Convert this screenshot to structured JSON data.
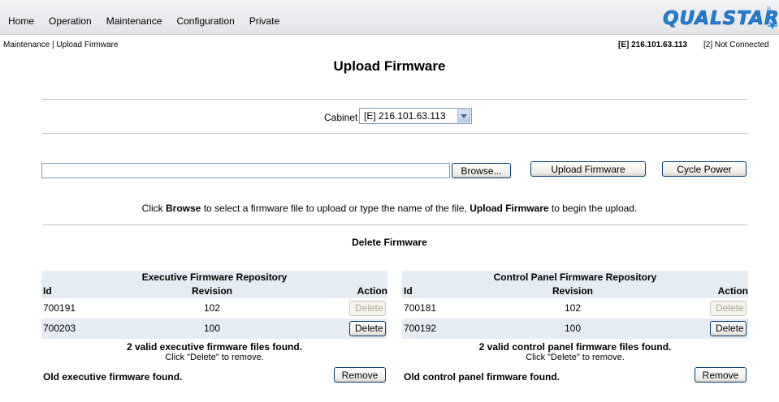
{
  "nav": [
    "Home",
    "Operation",
    "Maintenance",
    "Configuration",
    "Private"
  ],
  "logo": "QUALSTAR",
  "breadcrumb": "Maintenance | Upload Firmware",
  "connection": {
    "primary": "[E] 216.101.63.113",
    "secondary": "[2] Not Connected"
  },
  "page_title": "Upload Firmware",
  "cabinet": {
    "label": "Cabinet",
    "selected": "[E] 216.101.63.113"
  },
  "upload": {
    "file_value": "",
    "browse_label": "Browse...",
    "upload_label": "Upload Firmware",
    "cycle_label": "Cycle Power",
    "hint_pre": "Click ",
    "hint_b1": "Browse",
    "hint_mid": " to select a firmware file to upload or type the name of the file, ",
    "hint_b2": "Upload Firmware",
    "hint_post": " to begin the upload."
  },
  "delete_title": "Delete Firmware",
  "executive": {
    "title": "Executive Firmware Repository",
    "columns": [
      "Id",
      "Revision",
      "Action"
    ],
    "rows": [
      {
        "id": "700191",
        "revision": "102",
        "action": "Delete",
        "enabled": false
      },
      {
        "id": "700203",
        "revision": "100",
        "action": "Delete",
        "enabled": true
      }
    ],
    "found": "2 valid executive firmware files found.",
    "instruction": "Click \"Delete\" to remove.",
    "old_text": "Old executive firmware found.",
    "remove_label": "Remove"
  },
  "control_panel": {
    "title": "Control Panel Firmware Repository",
    "columns": [
      "Id",
      "Revision",
      "Action"
    ],
    "rows": [
      {
        "id": "700181",
        "revision": "102",
        "action": "Delete",
        "enabled": false
      },
      {
        "id": "700192",
        "revision": "100",
        "action": "Delete",
        "enabled": true
      }
    ],
    "found": "2 valid control panel firmware files found.",
    "instruction": "Click \"Delete\" to remove.",
    "old_text": "Old control panel firmware found.",
    "remove_label": "Remove"
  },
  "colors": {
    "accent": "#1f7fd4",
    "row_shade": "#e6ecf3"
  }
}
